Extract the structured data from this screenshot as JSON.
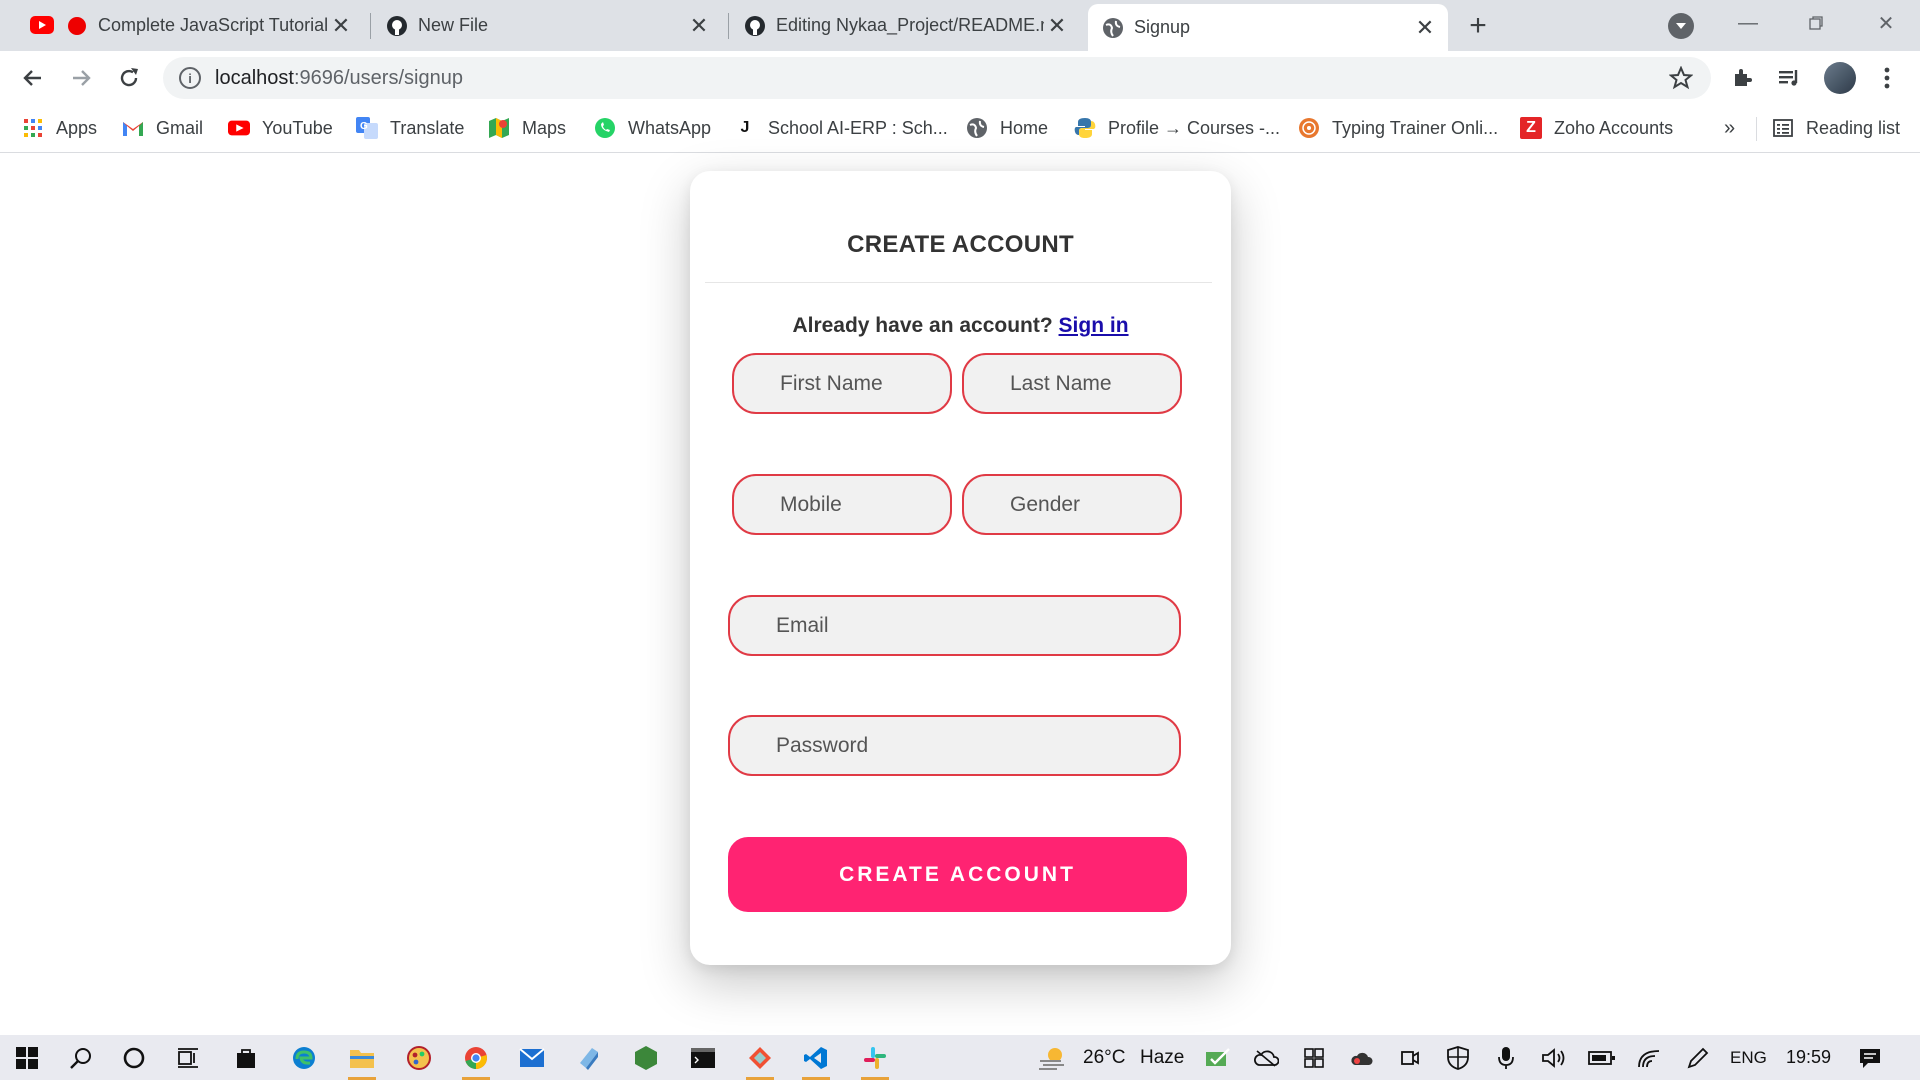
{
  "browser": {
    "tabs": [
      {
        "title": "Complete JavaScript Tutorial",
        "icon": "youtube-icon"
      },
      {
        "title": "New File",
        "icon": "github-icon"
      },
      {
        "title": "Editing Nykaa_Project/README.md",
        "icon": "github-icon"
      },
      {
        "title": "Signup",
        "icon": "globe-icon",
        "active": true
      }
    ],
    "url_host": "localhost",
    "url_path": ":9696/users/signup",
    "bookmarks": [
      {
        "label": "Apps",
        "icon": "apps-grid-icon"
      },
      {
        "label": "Gmail",
        "icon": "gmail-icon"
      },
      {
        "label": "YouTube",
        "icon": "youtube-icon"
      },
      {
        "label": "Translate",
        "icon": "translate-icon"
      },
      {
        "label": "Maps",
        "icon": "maps-icon"
      },
      {
        "label": "WhatsApp",
        "icon": "whatsapp-icon"
      },
      {
        "label": "School AI-ERP : Sch...",
        "icon": "erp-icon"
      },
      {
        "label": "Home",
        "icon": "globe-icon"
      },
      {
        "label": "Profile → Courses -...",
        "icon": "python-icon"
      },
      {
        "label": "Typing Trainer Onli...",
        "icon": "typing-trainer-icon"
      },
      {
        "label": "Zoho Accounts",
        "icon": "zoho-icon"
      }
    ],
    "more_bookmarks": "»",
    "reading_list": "Reading list"
  },
  "signup": {
    "title": "CREATE ACCOUNT",
    "signin_prompt": "Already have an account?",
    "signin_link": "Sign in",
    "first_name_placeholder": "First Name",
    "last_name_placeholder": "Last Name",
    "mobile_placeholder": "Mobile",
    "gender_placeholder": "Gender",
    "email_placeholder": "Email",
    "password_placeholder": "Password",
    "submit_label": "CREATE ACCOUNT"
  },
  "colors": {
    "accent": "#ff2372",
    "field_border": "#e03a45",
    "link": "#1a0dab"
  },
  "taskbar": {
    "weather_temp": "26°C",
    "weather_desc": "Haze",
    "language": "ENG",
    "time": "19:59"
  }
}
